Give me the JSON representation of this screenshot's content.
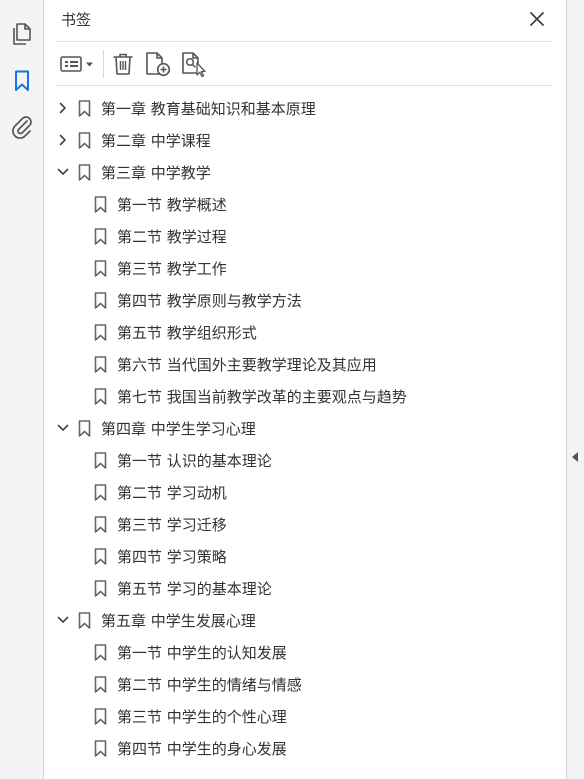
{
  "panel": {
    "title": "书签"
  },
  "rail": {
    "icons": [
      "pages-icon",
      "bookmark-icon",
      "attachment-icon"
    ],
    "active_color": "#1473e6"
  },
  "toolbar": {
    "icons": [
      "options-menu-icon",
      "delete-icon",
      "new-bookmark-icon",
      "find-bookmark-icon"
    ]
  },
  "bookmarks": [
    {
      "label": "第一章  教育基础知识和基本原理",
      "level": 0,
      "expandable": true,
      "expanded": false
    },
    {
      "label": "第二章  中学课程",
      "level": 0,
      "expandable": true,
      "expanded": false
    },
    {
      "label": "第三章  中学教学",
      "level": 0,
      "expandable": true,
      "expanded": true
    },
    {
      "label": "第一节  教学概述",
      "level": 1
    },
    {
      "label": "第二节  教学过程",
      "level": 1
    },
    {
      "label": "第三节  教学工作",
      "level": 1
    },
    {
      "label": "第四节  教学原则与教学方法",
      "level": 1
    },
    {
      "label": "第五节  教学组织形式",
      "level": 1
    },
    {
      "label": "第六节  当代国外主要教学理论及其应用",
      "level": 1
    },
    {
      "label": "第七节  我国当前教学改革的主要观点与趋势",
      "level": 1
    },
    {
      "label": "第四章  中学生学习心理",
      "level": 0,
      "expandable": true,
      "expanded": true
    },
    {
      "label": "第一节  认识的基本理论",
      "level": 1
    },
    {
      "label": "第二节  学习动机",
      "level": 1
    },
    {
      "label": "第三节  学习迁移",
      "level": 1
    },
    {
      "label": "第四节  学习策略",
      "level": 1
    },
    {
      "label": "第五节  学习的基本理论",
      "level": 1
    },
    {
      "label": "第五章  中学生发展心理",
      "level": 0,
      "expandable": true,
      "expanded": true
    },
    {
      "label": "第一节  中学生的认知发展",
      "level": 1
    },
    {
      "label": "第二节  中学生的情绪与情感",
      "level": 1
    },
    {
      "label": "第三节  中学生的个性心理",
      "level": 1
    },
    {
      "label": "第四节  中学生的身心发展",
      "level": 1
    }
  ]
}
